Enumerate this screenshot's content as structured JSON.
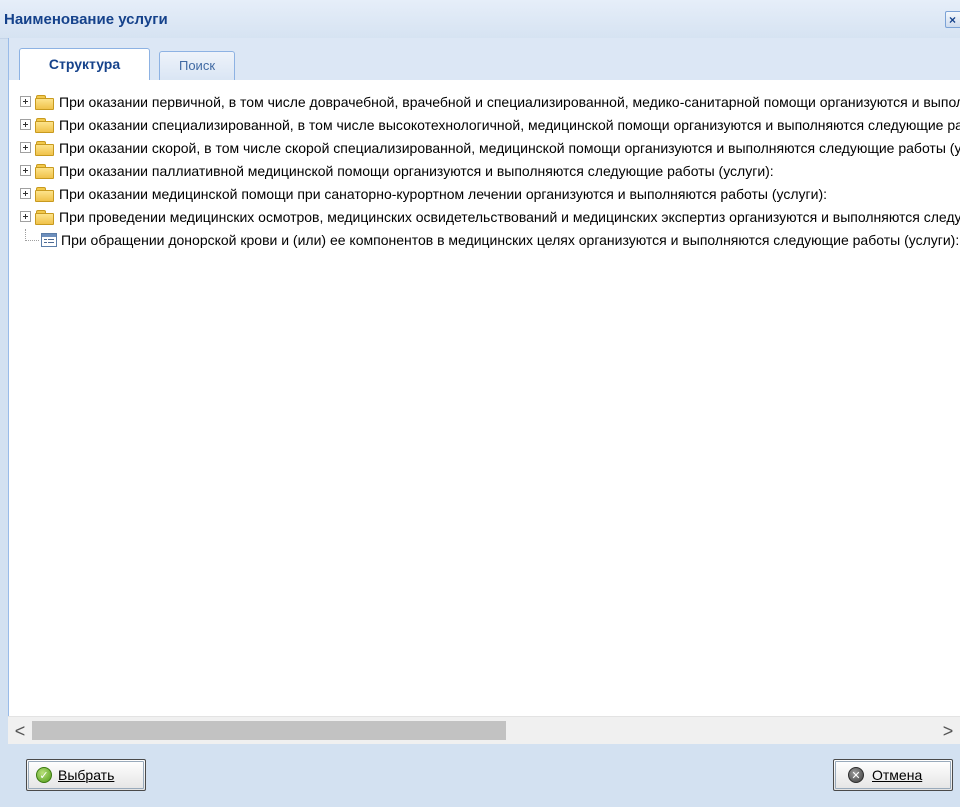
{
  "window": {
    "title": "Наименование услуги",
    "close_glyph": "×",
    "colors": {
      "title_text": "#15428b",
      "panel_bg": "#d3e1f1",
      "tab_border": "#99bbe8"
    }
  },
  "tabs": [
    {
      "label": "Структура",
      "active": true
    },
    {
      "label": "Поиск",
      "active": false
    }
  ],
  "tree": {
    "nodes": [
      {
        "type": "folder",
        "icon": "folder-icon",
        "expander": "plus-icon",
        "label": "При оказании первичной, в том числе доврачебной, врачебной и специализированной, медико-санитарной помощи организуются и выполняются следующие работы (услуги):"
      },
      {
        "type": "folder",
        "icon": "folder-icon",
        "expander": "plus-icon",
        "label": "При оказании специализированной, в том числе высокотехнологичной, медицинской помощи организуются и выполняются следующие работы (услуги):"
      },
      {
        "type": "folder",
        "icon": "folder-icon",
        "expander": "plus-icon",
        "label": "При оказании скорой, в том числе скорой специализированной, медицинской помощи организуются и выполняются следующие работы (услуги):"
      },
      {
        "type": "folder",
        "icon": "folder-icon",
        "expander": "plus-icon",
        "label": "При оказании паллиативной медицинской помощи организуются и выполняются следующие работы (услуги):"
      },
      {
        "type": "folder",
        "icon": "folder-icon",
        "expander": "plus-icon",
        "label": "При оказании медицинской помощи при санаторно-курортном лечении организуются и выполняются работы (услуги):"
      },
      {
        "type": "folder",
        "icon": "folder-icon",
        "expander": "plus-icon",
        "label": "При проведении медицинских осмотров, медицинских освидетельствований и медицинских экспертиз организуются и выполняются следующие работы (услуги):"
      },
      {
        "type": "leaf",
        "icon": "document-list-icon",
        "label": "При обращении донорской крови и (или) ее компонентов в медицинских целях организуются и выполняются следующие работы (услуги):"
      }
    ]
  },
  "scrollbar": {
    "left_arrow": "<",
    "right_arrow": ">",
    "thumb_position_fraction": 0.0,
    "thumb_size_fraction": 0.5
  },
  "buttons": {
    "select": {
      "label": "Выбрать",
      "icon": "ok-check-icon"
    },
    "cancel": {
      "label": "Отмена",
      "icon": "cancel-x-icon"
    }
  }
}
